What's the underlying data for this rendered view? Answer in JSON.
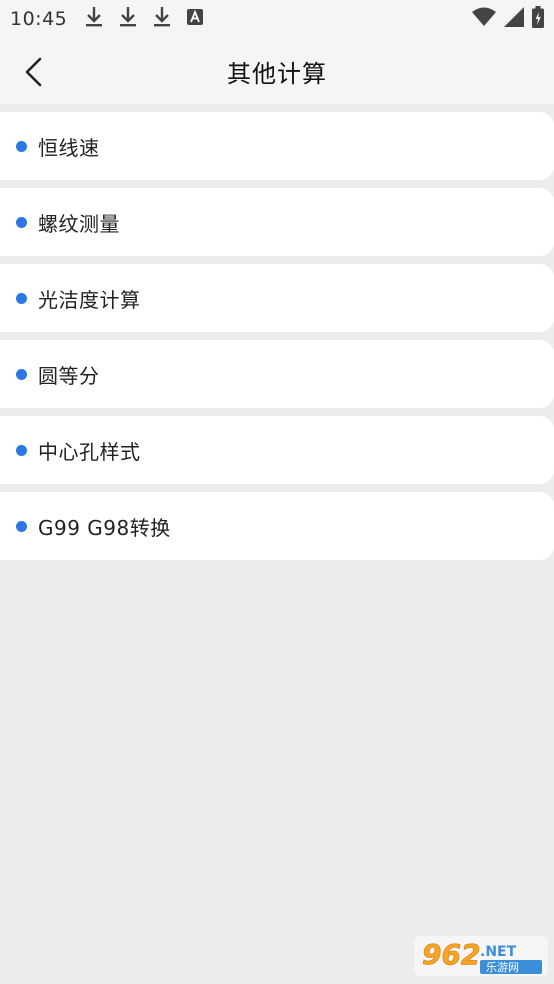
{
  "status_bar": {
    "time": "10:45",
    "icons": [
      "download-icon",
      "download-icon",
      "download-icon",
      "font-a-icon",
      "wifi-icon",
      "signal-icon",
      "battery-icon"
    ]
  },
  "header": {
    "title": "其他计算",
    "back_icon": "chevron-left-icon"
  },
  "menu": {
    "bullet_color": "#2b78e4",
    "items": [
      {
        "label": "恒线速"
      },
      {
        "label": "螺纹测量"
      },
      {
        "label": "光洁度计算"
      },
      {
        "label": "圆等分"
      },
      {
        "label": "中心孔样式"
      },
      {
        "label": "G99 G98转换"
      }
    ]
  },
  "watermark": {
    "brand_number": "962",
    "brand_suffix": ".NET",
    "brand_cn": "乐游网"
  }
}
